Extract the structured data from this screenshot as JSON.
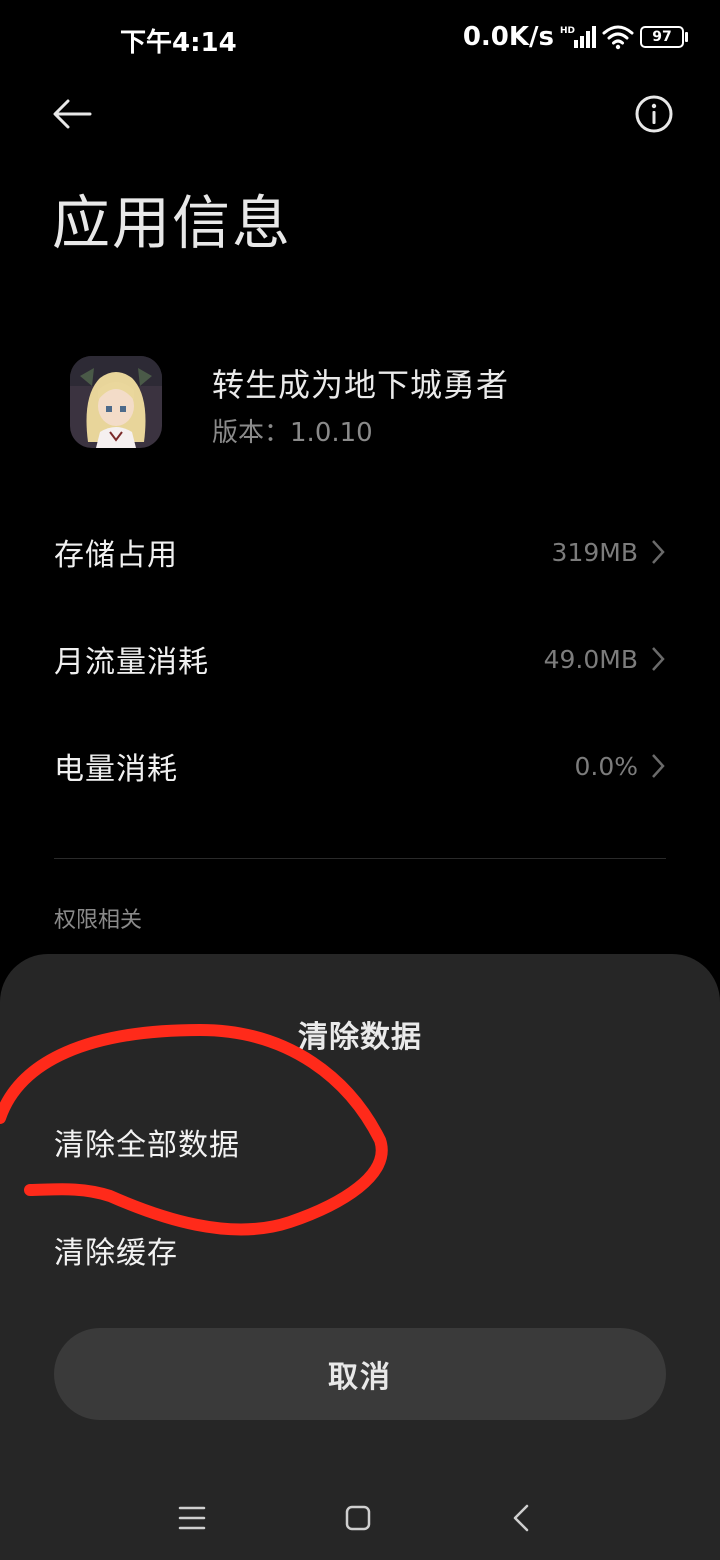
{
  "status_bar": {
    "time": "下午4:14",
    "net_speed": "0.0K/s",
    "battery": "97"
  },
  "header": {
    "title": "应用信息",
    "back_icon": "back-arrow-icon",
    "info_icon": "info-icon"
  },
  "app": {
    "name": "转生成为地下城勇者",
    "version_label": "版本：",
    "version_value": "1.0.10"
  },
  "rows": [
    {
      "label": "存储占用",
      "value": "319MB"
    },
    {
      "label": "月流量消耗",
      "value": "49.0MB"
    },
    {
      "label": "电量消耗",
      "value": "0.0%"
    }
  ],
  "section_header": "权限相关",
  "sheet": {
    "title": "清除数据",
    "options": [
      "清除全部数据",
      "清除缓存"
    ],
    "cancel": "取消"
  },
  "colors": {
    "background": "#000000",
    "sheet": "#262626",
    "button": "#3a3a3a",
    "annotation": "#ff2a1a"
  }
}
